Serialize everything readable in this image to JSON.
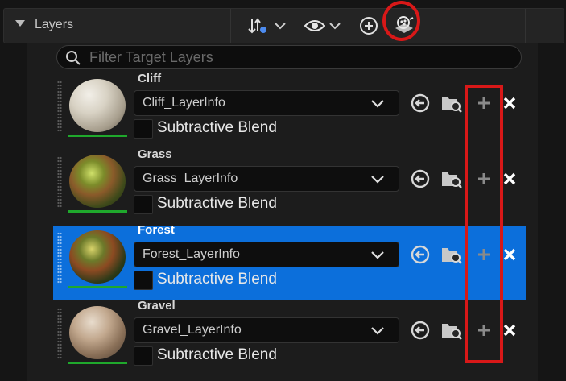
{
  "panel": {
    "title": "Layers",
    "toolbar_icons": [
      "sort-filter-icon",
      "chevron-down-icon",
      "eye-icon",
      "chevron-down-icon",
      "add-circle-icon",
      "layer-paint-icon"
    ]
  },
  "search": {
    "placeholder": "Filter Target Layers"
  },
  "subtractive_label": "Subtractive Blend",
  "layers": [
    {
      "name": "Cliff",
      "info": "Cliff_LayerInfo",
      "selected": false,
      "subtractive": false
    },
    {
      "name": "Grass",
      "info": "Grass_LayerInfo",
      "selected": false,
      "subtractive": false
    },
    {
      "name": "Forest",
      "info": "Forest_LayerInfo",
      "selected": true,
      "subtractive": false
    },
    {
      "name": "Gravel",
      "info": "Gravel_LayerInfo",
      "selected": false,
      "subtractive": false
    }
  ],
  "row_icons": [
    "use-selected-icon",
    "browse-asset-icon",
    "create-layer-info-icon",
    "delete-icon"
  ],
  "colors": {
    "accent": "#0c6fdb",
    "highlight": "#d81818",
    "weight_bar": "#1fa82c"
  }
}
